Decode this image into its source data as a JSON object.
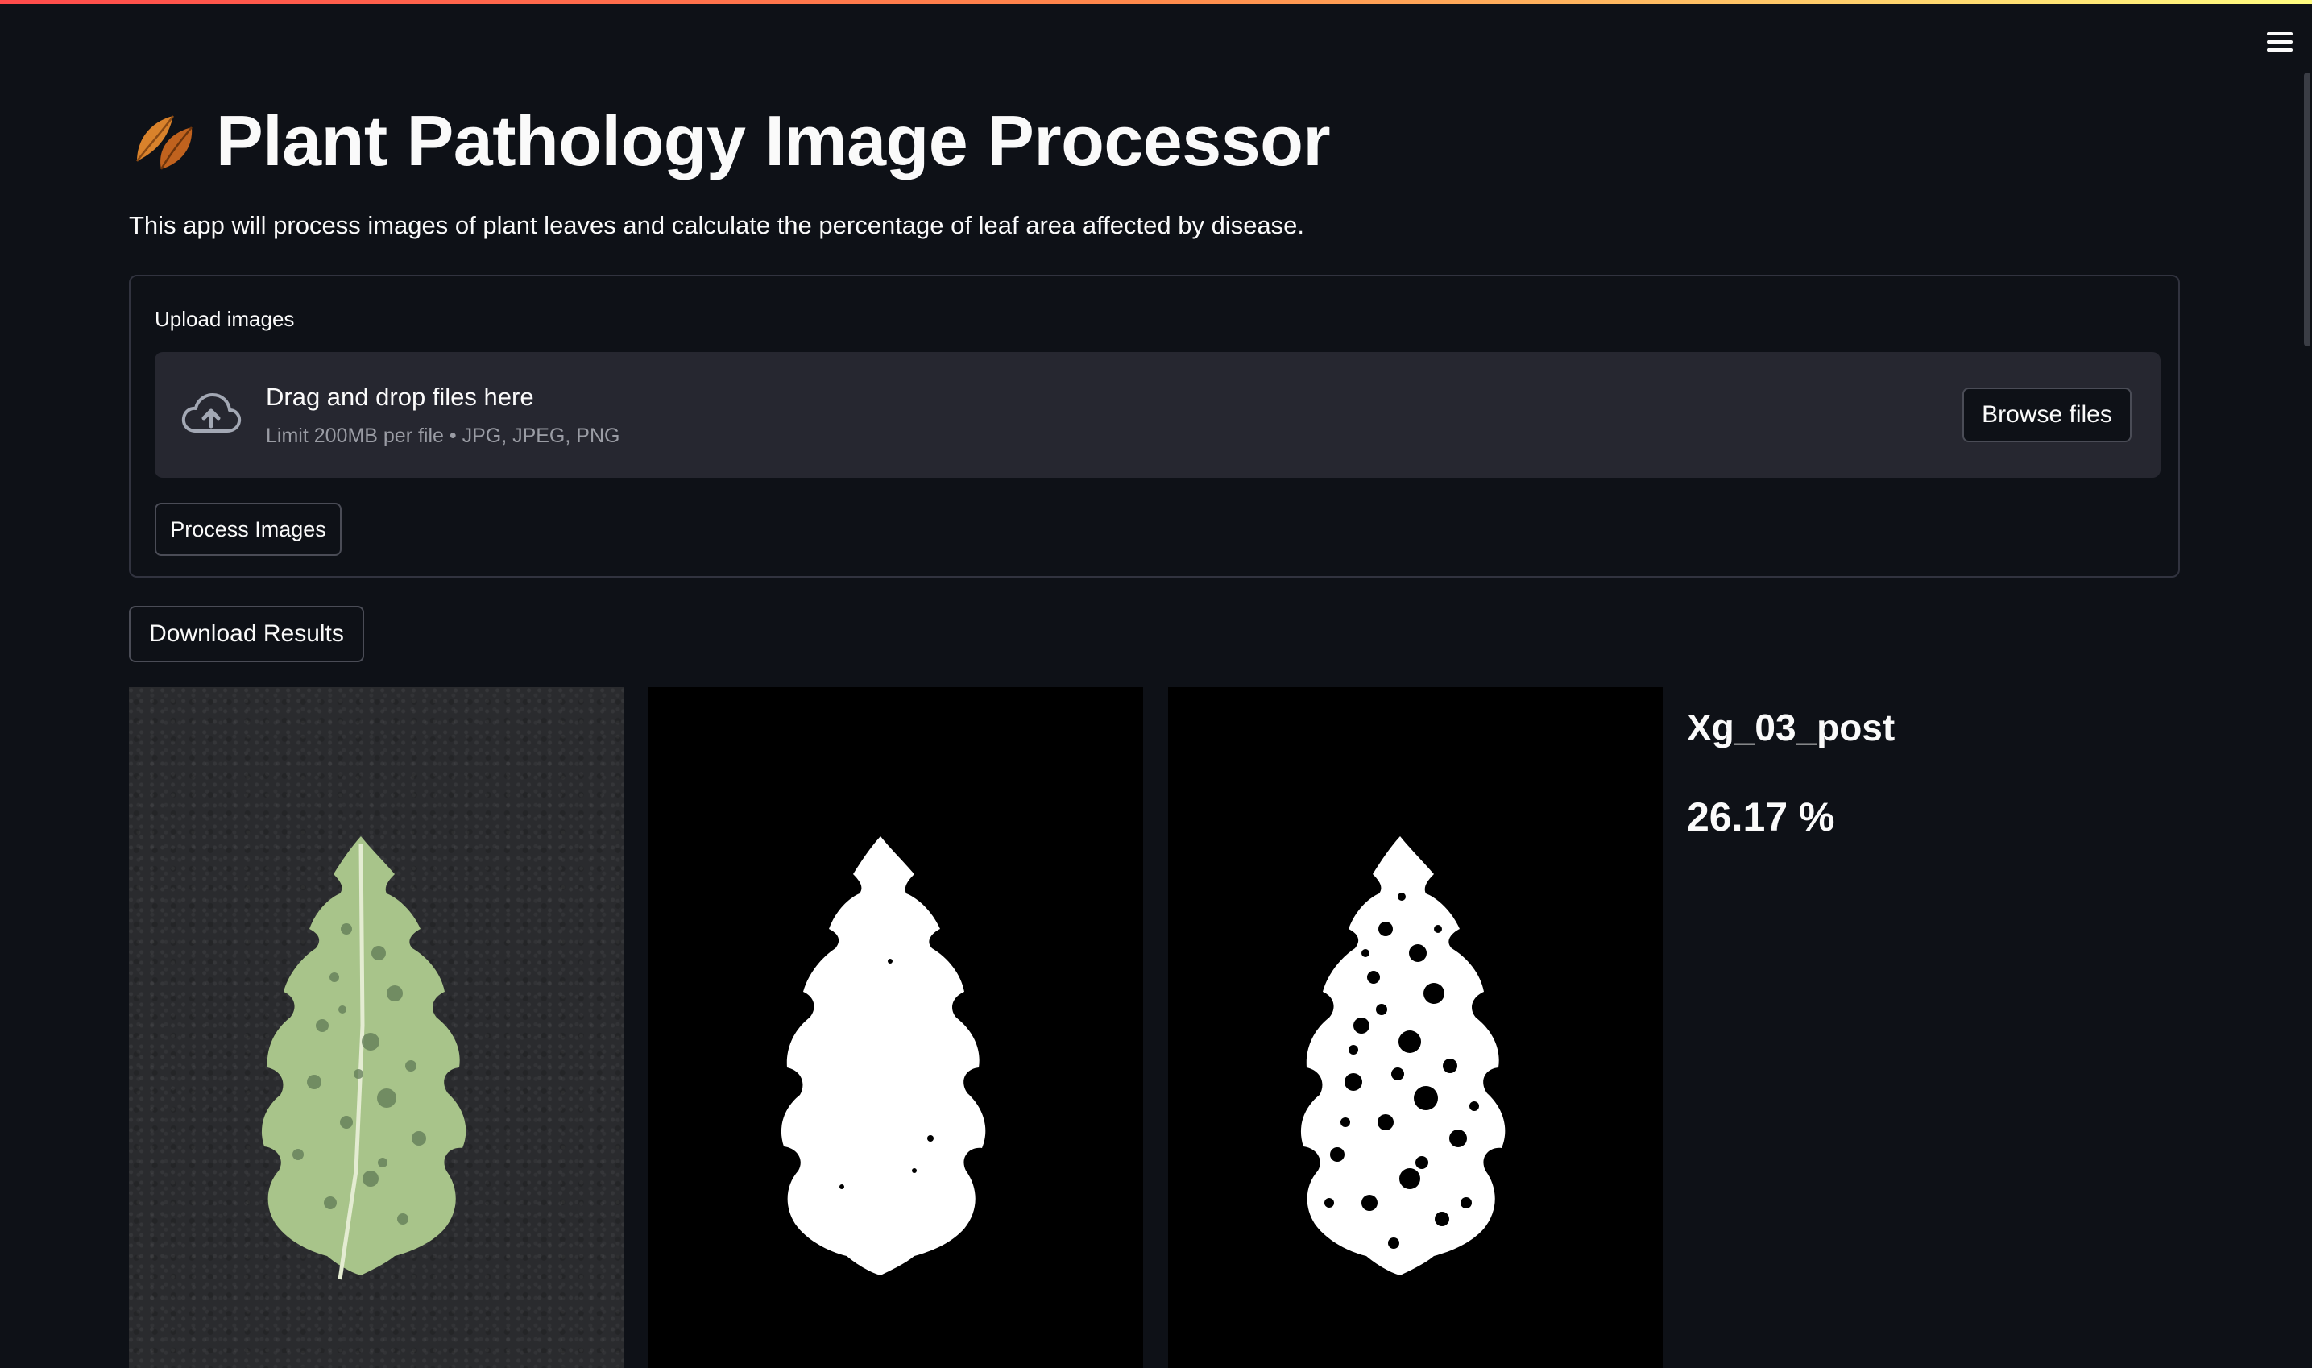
{
  "app": {
    "title": "Plant Pathology Image Processor",
    "title_icon": "fallen-leaf-icon",
    "description": "This app will process images of plant leaves and calculate the percentage of leaf area affected by disease."
  },
  "header": {
    "menu_icon": "hamburger-menu-icon"
  },
  "uploader": {
    "label": "Upload images",
    "drop_title": "Drag and drop files here",
    "drop_limit": "Limit 200MB per file • JPG, JPEG, PNG",
    "browse_label": "Browse files",
    "icon": "cloud-upload-icon"
  },
  "actions": {
    "process_label": "Process Images",
    "download_label": "Download Results"
  },
  "result": {
    "image_name": "Xg_03_post",
    "percentage": "26.17 %"
  },
  "colors": {
    "background": "#0e1117",
    "panel": "#262730",
    "border": "#31333f",
    "text": "#fafafa",
    "muted": "#9a9ca4",
    "leaf": "#a8c48a",
    "leaf_spots": "#5f7a55"
  }
}
